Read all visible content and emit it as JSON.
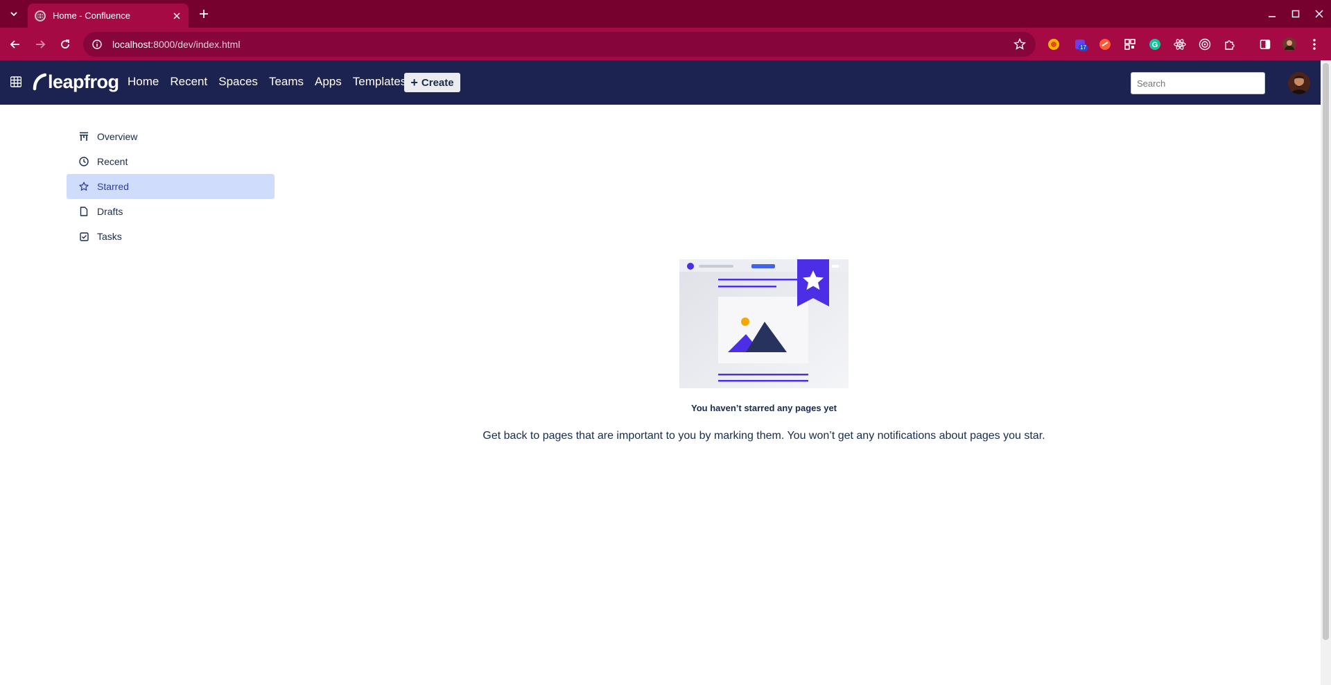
{
  "browser": {
    "tab_title": "Home - Confluence",
    "url_host": "localhost",
    "url_rest": ":8000/dev/index.html",
    "extension_badge": "17"
  },
  "header": {
    "logo_text": "leapfrog",
    "nav": [
      {
        "label": "Home"
      },
      {
        "label": "Recent"
      },
      {
        "label": "Spaces"
      },
      {
        "label": "Teams"
      },
      {
        "label": "Apps"
      },
      {
        "label": "Templates"
      }
    ],
    "create_label": "Create",
    "search_placeholder": "Search"
  },
  "sidebar": {
    "items": [
      {
        "label": "Overview",
        "icon": "overview-icon"
      },
      {
        "label": "Recent",
        "icon": "clock-icon"
      },
      {
        "label": "Starred",
        "icon": "star-icon",
        "active": true
      },
      {
        "label": "Drafts",
        "icon": "document-icon"
      },
      {
        "label": "Tasks",
        "icon": "checkbox-icon"
      }
    ]
  },
  "empty_state": {
    "title": "You haven’t starred any pages yet",
    "description": "Get back to pages that are important to you by marking them. You won’t get any notifications about pages you star."
  },
  "colors": {
    "chrome_dark": "#76002e",
    "chrome": "#a50a45",
    "header": "#1d2350",
    "active_item": "#cfdcfc",
    "accent": "#4b2ee6"
  }
}
